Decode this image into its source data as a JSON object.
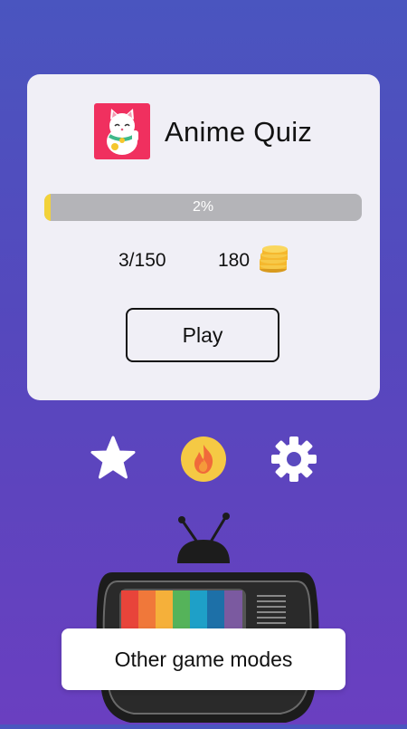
{
  "card": {
    "app_title": "Anime Quiz",
    "progress": {
      "label": "2%",
      "fraction": 0.02,
      "fill_color": "#f2d23a"
    },
    "levels_text": "3/150",
    "coins_text": "180",
    "play_label": "Play"
  },
  "icons": {
    "app": "lucky-cat-icon",
    "coins": "coins-stack-icon",
    "favorites": "star-icon",
    "streak": "fire-icon",
    "settings": "gear-icon",
    "tv": "retro-tv-icon"
  },
  "footer": {
    "other_modes_label": "Other game modes"
  },
  "colors": {
    "accent_pink": "#f0305f",
    "coin_gold": "#f5b82e",
    "fire_bg": "#f5c944"
  }
}
